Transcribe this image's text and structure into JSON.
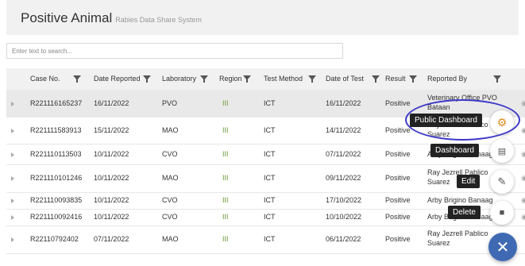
{
  "header": {
    "title": "Positive Animal",
    "subtitle": "Rabies Data Share System"
  },
  "search": {
    "placeholder": "Enter text to search..."
  },
  "columns": [
    "Case No.",
    "Date Reported",
    "Laboratory",
    "Region",
    "Test Method",
    "Date of Test",
    "Result",
    "Reported By"
  ],
  "rows": [
    {
      "case_no": "R221116165237",
      "date_reported": "16/11/2022",
      "laboratory": "PVO",
      "region": "III",
      "test_method": "ICT",
      "date_of_test": "16/11/2022",
      "result": "Positive",
      "reported_by_1": "Veterinary Office PVO",
      "reported_by_2": "Bataan"
    },
    {
      "case_no": "R221111583913",
      "date_reported": "15/11/2022",
      "laboratory": "MAO",
      "region": "III",
      "test_method": "ICT",
      "date_of_test": "14/11/2022",
      "result": "Positive",
      "reported_by_1": "Ray Jezrell Pablico",
      "reported_by_2": "Suarez"
    },
    {
      "case_no": "R221110113503",
      "date_reported": "10/11/2022",
      "laboratory": "CVO",
      "region": "III",
      "test_method": "ICT",
      "date_of_test": "07/11/2022",
      "result": "Positive",
      "reported_by_1": "Arby Brigino Banaag",
      "reported_by_2": ""
    },
    {
      "case_no": "R221110101246",
      "date_reported": "10/11/2022",
      "laboratory": "MAO",
      "region": "III",
      "test_method": "ICT",
      "date_of_test": "09/11/2022",
      "result": "Positive",
      "reported_by_1": "Ray Jezrell Pablico",
      "reported_by_2": "Suarez"
    },
    {
      "case_no": "R221110093835",
      "date_reported": "10/11/2022",
      "laboratory": "CVO",
      "region": "III",
      "test_method": "ICT",
      "date_of_test": "17/10/2022",
      "result": "Positive",
      "reported_by_1": "Arby Brigino Banaag",
      "reported_by_2": ""
    },
    {
      "case_no": "R221110092416",
      "date_reported": "10/11/2022",
      "laboratory": "CVO",
      "region": "III",
      "test_method": "ICT",
      "date_of_test": "10/10/2022",
      "result": "Positive",
      "reported_by_1": "Arby Brigino Banaag",
      "reported_by_2": ""
    },
    {
      "case_no": "R22110792402",
      "date_reported": "07/11/2022",
      "laboratory": "MAO",
      "region": "III",
      "test_method": "ICT",
      "date_of_test": "06/11/2022",
      "result": "Positive",
      "reported_by_1": "Ray Jezrell Pablico",
      "reported_by_2": "Suarez"
    }
  ],
  "actions": {
    "public_dashboard": "Public Dashboard",
    "dashboard": "Dashboard",
    "edit": "Edit",
    "delete": "Delete"
  },
  "colors": {
    "accent": "#3f6ab3",
    "highlight": "#3d39c8",
    "region_text": "#6a9a32"
  }
}
